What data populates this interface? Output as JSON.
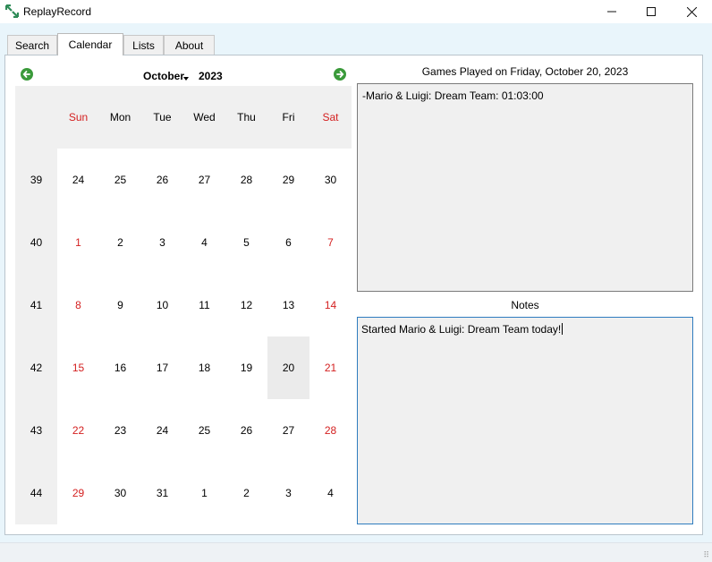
{
  "window": {
    "title": "ReplayRecord",
    "minimize_icon": "minimize-icon",
    "maximize_icon": "maximize-icon",
    "close_icon": "close-icon"
  },
  "tabs": [
    {
      "label": "Search"
    },
    {
      "label": "Calendar",
      "active": true
    },
    {
      "label": "Lists"
    },
    {
      "label": "About"
    }
  ],
  "calendar": {
    "month": "October",
    "year": "2023",
    "prev_icon": "arrow-left-icon",
    "next_icon": "arrow-right-icon",
    "weekdays": [
      "Sun",
      "Mon",
      "Tue",
      "Wed",
      "Thu",
      "Fri",
      "Sat"
    ],
    "weekend_color": "#d42020",
    "selected_day": "20",
    "weeks": [
      {
        "week": "39",
        "days": [
          "24",
          "25",
          "26",
          "27",
          "28",
          "29",
          "30"
        ]
      },
      {
        "week": "40",
        "days": [
          "1",
          "2",
          "3",
          "4",
          "5",
          "6",
          "7"
        ]
      },
      {
        "week": "41",
        "days": [
          "8",
          "9",
          "10",
          "11",
          "12",
          "13",
          "14"
        ]
      },
      {
        "week": "42",
        "days": [
          "15",
          "16",
          "17",
          "18",
          "19",
          "20",
          "21"
        ]
      },
      {
        "week": "43",
        "days": [
          "22",
          "23",
          "24",
          "25",
          "26",
          "27",
          "28"
        ]
      },
      {
        "week": "44",
        "days": [
          "29",
          "30",
          "31",
          "1",
          "2",
          "3",
          "4"
        ]
      }
    ]
  },
  "games": {
    "title": "Games Played on Friday, October 20, 2023",
    "entries": [
      "-Mario & Luigi: Dream Team: 01:03:00"
    ]
  },
  "notes": {
    "title": "Notes",
    "text": "Started Mario & Luigi: Dream Team today!"
  }
}
